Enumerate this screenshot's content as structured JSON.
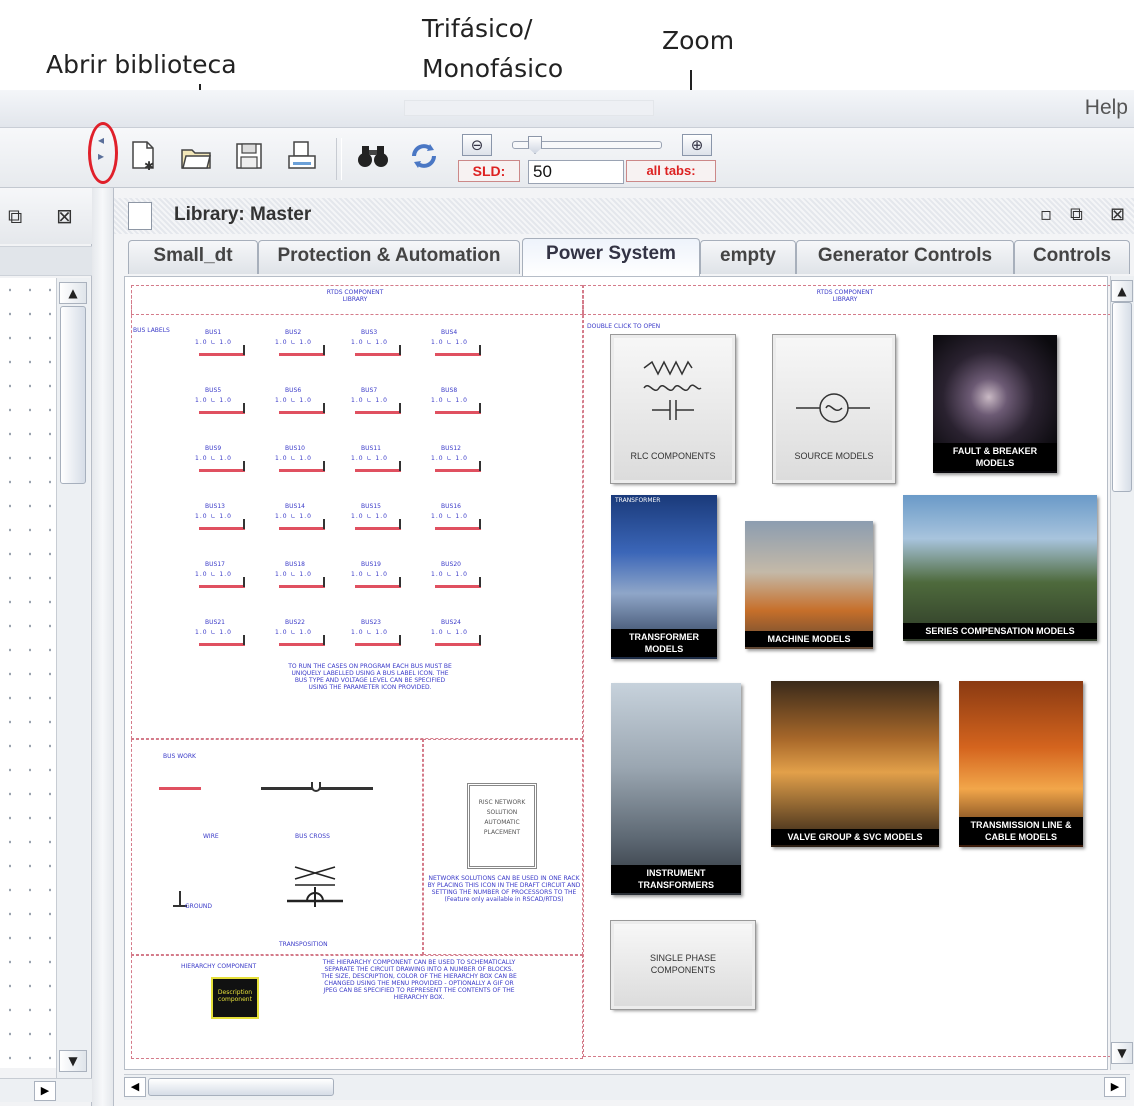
{
  "annotations": {
    "open_library": "Abrir biblioteca",
    "three_phase_line1": "Trifásico/",
    "three_phase_line2": "Monofásico",
    "zoom": "Zoom"
  },
  "menubar": {
    "help": "Help"
  },
  "toolbar": {
    "sld_label": "SLD:",
    "zoom_value": "50",
    "all_tabs_label": "all tabs:",
    "icons": [
      "new-file-icon",
      "open-folder-icon",
      "save-icon",
      "print-icon",
      "binoculars-icon",
      "refresh-icon"
    ]
  },
  "library": {
    "title": "Library: Master",
    "tabs": [
      "Small_dt",
      "Protection & Automation",
      "Power System",
      "empty",
      "Generator Controls",
      "Controls"
    ],
    "active_tab": "Power System"
  },
  "canvas": {
    "left_header_line1": "RTDS COMPONENT",
    "left_header_line2": "LIBRARY",
    "right_header_line1": "RTDS COMPONENT",
    "right_header_line2": "LIBRARY",
    "buslabels_caption": "BUS LABELS",
    "double_click": "DOUBLE CLICK TO OPEN",
    "buses": [
      "BUS1",
      "BUS2",
      "BUS3",
      "BUS4",
      "BUS5",
      "BUS6",
      "BUS7",
      "BUS8",
      "BUS9",
      "BUS10",
      "BUS11",
      "BUS12",
      "BUS13",
      "BUS14",
      "BUS15",
      "BUS16",
      "BUS17",
      "BUS18",
      "BUS19",
      "BUS20",
      "BUS21",
      "BUS22",
      "BUS23",
      "BUS24"
    ],
    "bus_values": "1.0  ∟  1.0",
    "bus_note": "TO RUN THE CASES ON PROGRAM EACH BUS MUST BE UNIQUELY LABELLED USING A BUS LABEL ICON. THE BUS TYPE AND VOLTAGE LEVEL CAN BE SPECIFIED USING THE PARAMETER ICON PROVIDED.",
    "busworks": "BUS WORK",
    "wire": "WIRE",
    "buscross": "BUS CROSS",
    "ground": "GROUND",
    "transposition": "TRANSPOSITION",
    "network_box": "RISC NETWORK SOLUTION AUTOMATIC PLACEMENT",
    "network_note": "NETWORK SOLUTIONS CAN BE USED IN ONE RACK BY PLACING THIS ICON IN THE DRAFT CIRCUIT AND SETTING THE NUMBER OF PROCESSORS TO THE (Feature only available in RSCAD/RTDS)",
    "hierarchy_title": "HIERARCHY COMPONENT",
    "hierarchy_box": "Description component",
    "hierarchy_note": "THE HIERARCHY COMPONENT CAN BE USED TO SCHEMATICALLY SEPARATE THE CIRCUIT DRAWING INTO A NUMBER OF BLOCKS. THE SIZE, DESCRIPTION, COLOR OF THE HIERARCHY BOX CAN BE CHANGED USING THE MENU PROVIDED - OPTIONALLY A GIF OR JPEG CAN BE SPECIFIED TO REPRESENT THE CONTENTS OF THE HIERARCHY BOX.",
    "tiles": {
      "rlc": "RLC COMPONENTS",
      "source": "SOURCE MODELS",
      "fault": "FAULT & BREAKER MODELS",
      "transformer": "TRANSFORMER MODELS",
      "transformer_top": "TRANSFORMER",
      "machine": "MACHINE MODELS",
      "series": "SERIES COMPENSATION MODELS",
      "instrument": "INSTRUMENT TRANSFORMERS",
      "valve": "VALVE GROUP & SVC MODELS",
      "transmission": "TRANSMISSION LINE & CABLE MODELS",
      "single_phase": "SINGLE PHASE COMPONENTS"
    }
  }
}
